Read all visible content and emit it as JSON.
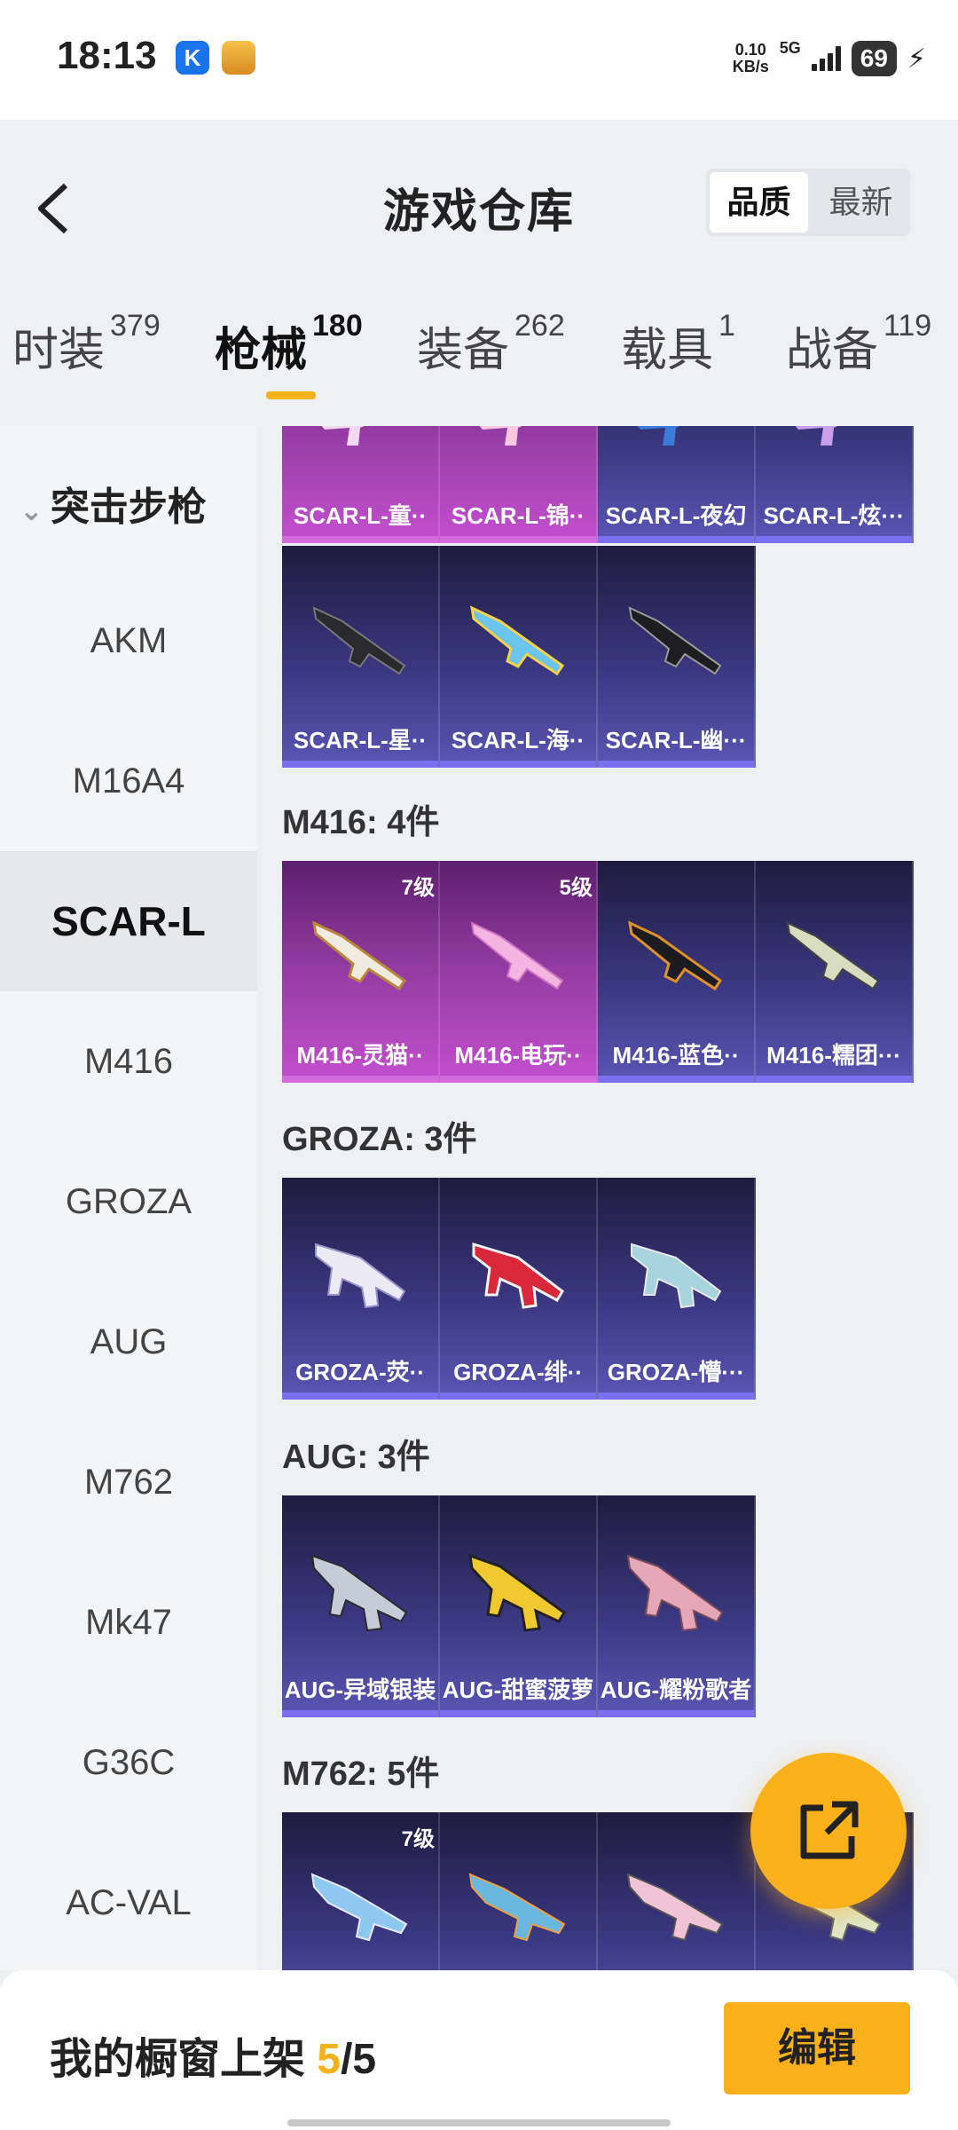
{
  "status": {
    "time": "18:13",
    "net_speed_top": "0.10",
    "net_speed_unit": "KB/s",
    "network": "5G",
    "battery": "69"
  },
  "header": {
    "title": "游戏仓库",
    "sort_quality": "品质",
    "sort_new": "最新"
  },
  "tabs": [
    {
      "label": "时装",
      "count": "379"
    },
    {
      "label": "枪械",
      "count": "180"
    },
    {
      "label": "装备",
      "count": "262"
    },
    {
      "label": "载具",
      "count": "1"
    },
    {
      "label": "战备",
      "count": "119"
    }
  ],
  "sidebar": {
    "category": "突击步枪",
    "items": [
      "AKM",
      "M16A4",
      "SCAR-L",
      "M416",
      "GROZA",
      "AUG",
      "M762",
      "Mk47",
      "G36C",
      "AC-VAL"
    ]
  },
  "sections": {
    "scar_row1": [
      "SCAR-L-童··",
      "SCAR-L-锦··",
      "SCAR-L-夜幻",
      "SCAR-L-炫···"
    ],
    "scar_row2": [
      "SCAR-L-星··",
      "SCAR-L-海··",
      "SCAR-L-幽···"
    ],
    "m416": {
      "title": "M416: 4件",
      "items": [
        "M416-灵猫··",
        "M416-电玩··",
        "M416-蓝色··",
        "M416-糯团···"
      ],
      "tags": [
        "7级",
        "5级"
      ]
    },
    "groza": {
      "title": "GROZA: 3件",
      "items": [
        "GROZA-荧··",
        "GROZA-绯··",
        "GROZA-懵···"
      ]
    },
    "aug": {
      "title": "AUG: 3件",
      "items": [
        "AUG-异域银装",
        "AUG-甜蜜菠萝",
        "AUG-耀粉歌者"
      ]
    },
    "m762": {
      "title": "M762: 5件",
      "tags": [
        "7级"
      ]
    }
  },
  "bottom": {
    "showcase_label": "我的橱窗上架",
    "showcase_count": "5",
    "showcase_sep": "/",
    "showcase_total": "5",
    "edit_label": "编辑"
  },
  "colors": {
    "accent": "#f8b11b",
    "card_purple": "#3a3780",
    "card_pink": "#9a3fa8"
  }
}
